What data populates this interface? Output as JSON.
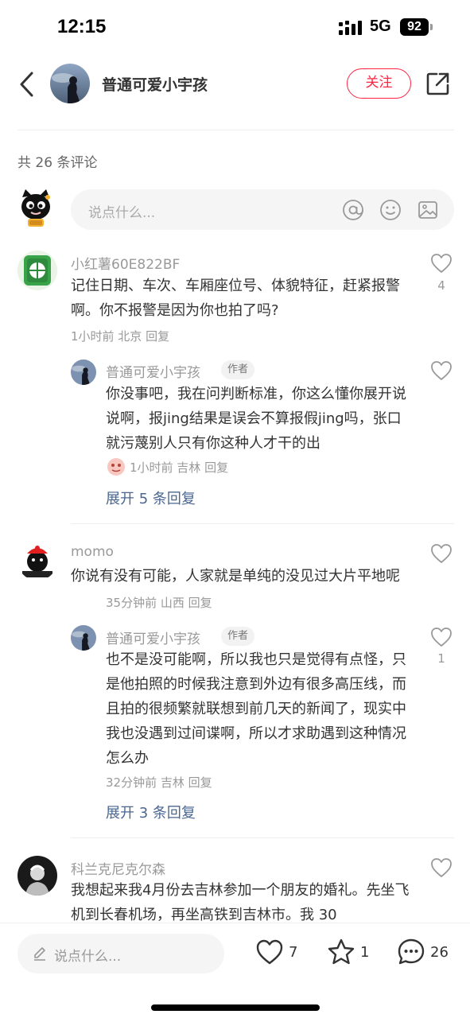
{
  "status": {
    "time": "12:15",
    "network": "5G",
    "battery": "92"
  },
  "header": {
    "username": "普通可爱小宇孩",
    "follow_label": "关注"
  },
  "comment_count": "共 26 条评论",
  "compose": {
    "placeholder": "说点什么..."
  },
  "comments": [
    {
      "user": "小红薯60E822BF",
      "text": "记住日期、车次、车厢座位号、体貌特征，赶紧报警啊。你不报警是因为你也拍了吗?",
      "meta": "1小时前 北京 回复",
      "likes": "4",
      "reply": {
        "user": "普通可爱小宇孩",
        "badge": "作者",
        "text": "你没事吧，我在问判断标准，你这么懂你展开说说啊，报jing结果是误会不算报假jing吗，张口就污蔑别人只有你这种人才干的出",
        "meta": "1小时前 吉林 回复",
        "likes": ""
      },
      "expand": "展开 5 条回复"
    },
    {
      "user": "momo",
      "text": "你说有没有可能，人家就是单纯的没见过大片平地呢",
      "meta": "35分钟前 山西 回复",
      "likes": "",
      "reply": {
        "user": "普通可爱小宇孩",
        "badge": "作者",
        "text": "也不是没可能啊，所以我也只是觉得有点怪，只是他拍照的时候我注意到外边有很多高压线，而且拍的很频繁就联想到前几天的新闻了，现实中我也没遇到过间谍啊，所以才求助遇到这种情况怎么办",
        "meta": "32分钟前 吉林 回复",
        "likes": "1"
      },
      "expand": "展开 3 条回复"
    },
    {
      "user": "科兰克尼克尔森",
      "text": "我想起来我4月份去吉林参加一个朋友的婚礼。先坐飞机到长春机场，再坐高铁到吉林市。我 30",
      "likes": ""
    }
  ],
  "bottom": {
    "placeholder": "说点什么...",
    "likes": "7",
    "favorites": "1",
    "comments": "26"
  },
  "colors": {
    "accent": "#ff2442",
    "link": "#4a6791"
  },
  "icons": [
    "back-icon",
    "share-icon",
    "at-icon",
    "emoji-icon",
    "image-icon",
    "heart-icon",
    "star-icon",
    "comment-icon",
    "pencil-icon"
  ]
}
